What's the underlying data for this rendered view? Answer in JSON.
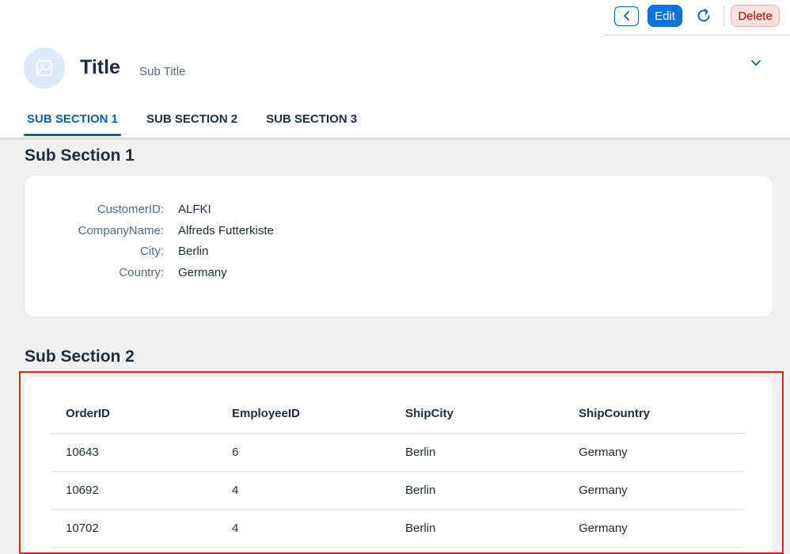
{
  "toolbar": {
    "edit_label": "Edit",
    "delete_label": "Delete"
  },
  "header": {
    "title": "Title",
    "subtitle": "Sub Title"
  },
  "tabs": [
    {
      "label": "SUB SECTION 1",
      "active": true
    },
    {
      "label": "SUB SECTION 2",
      "active": false
    },
    {
      "label": "SUB SECTION 3",
      "active": false
    }
  ],
  "section1": {
    "title": "Sub Section 1",
    "fields": [
      {
        "label": "CustomerID:",
        "value": "ALFKI"
      },
      {
        "label": "CompanyName:",
        "value": "Alfreds Futterkiste"
      },
      {
        "label": "City:",
        "value": "Berlin"
      },
      {
        "label": "Country:",
        "value": "Germany"
      }
    ]
  },
  "section2": {
    "title": "Sub Section 2",
    "columns": [
      "OrderID",
      "EmployeeID",
      "ShipCity",
      "ShipCountry"
    ],
    "rows": [
      [
        "10643",
        "6",
        "Berlin",
        "Germany"
      ],
      [
        "10692",
        "4",
        "Berlin",
        "Germany"
      ],
      [
        "10702",
        "4",
        "Berlin",
        "Germany"
      ]
    ]
  },
  "colors": {
    "accent": "#0b5fa8",
    "primary_button": "#0b74de",
    "delete_bg": "#ffdfdf",
    "highlight_border": "#e02020",
    "page_bg": "#f0f0f0"
  },
  "icons": {
    "back": "chevron-left-icon",
    "refresh": "refresh-icon",
    "avatar": "image-placeholder-icon",
    "collapse": "chevron-down-icon"
  }
}
